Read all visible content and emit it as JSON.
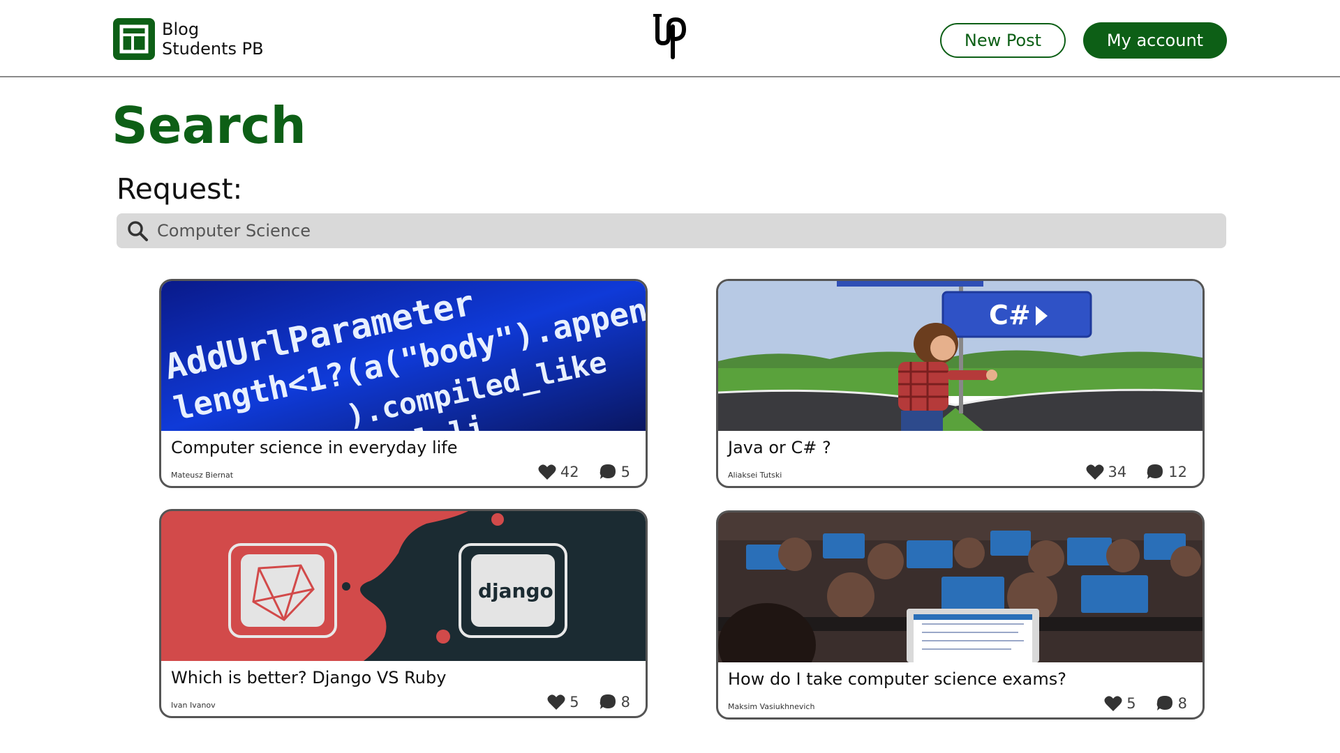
{
  "header": {
    "brand_line1": "Blog",
    "brand_line2": "Students PB",
    "new_post_label": "New Post",
    "account_label": "My account"
  },
  "colors": {
    "brand_green": "#0d5f16",
    "search_bg": "#d9d9d9"
  },
  "page": {
    "title": "Search",
    "request_label": "Request:"
  },
  "search": {
    "value": "Computer Science",
    "icon": "search-icon"
  },
  "cards": [
    {
      "title": "Computer science in everyday life",
      "author": "Mateusz Biernat",
      "likes": "42",
      "comments": "5"
    },
    {
      "title": "Java or C# ?",
      "author": "Aliaksei Tutski",
      "likes": "34",
      "comments": "12"
    },
    {
      "title": "Which is better? Django VS Ruby",
      "author": "Ivan Ivanov",
      "likes": "5",
      "comments": "8"
    },
    {
      "title": "How do I take computer science exams?",
      "author": "Maksim Vasiukhnevich",
      "likes": "5",
      "comments": "8"
    }
  ],
  "images": {
    "card1_text_1": "AddUrlParameter",
    "card1_text_2": "length<1?(a(\"body\").appen",
    "card1_text_3": ").compiled_like",
    "card1_text_4": "ul\"),(global.li",
    "card2_sign": "C#",
    "card3_badge": "django"
  }
}
